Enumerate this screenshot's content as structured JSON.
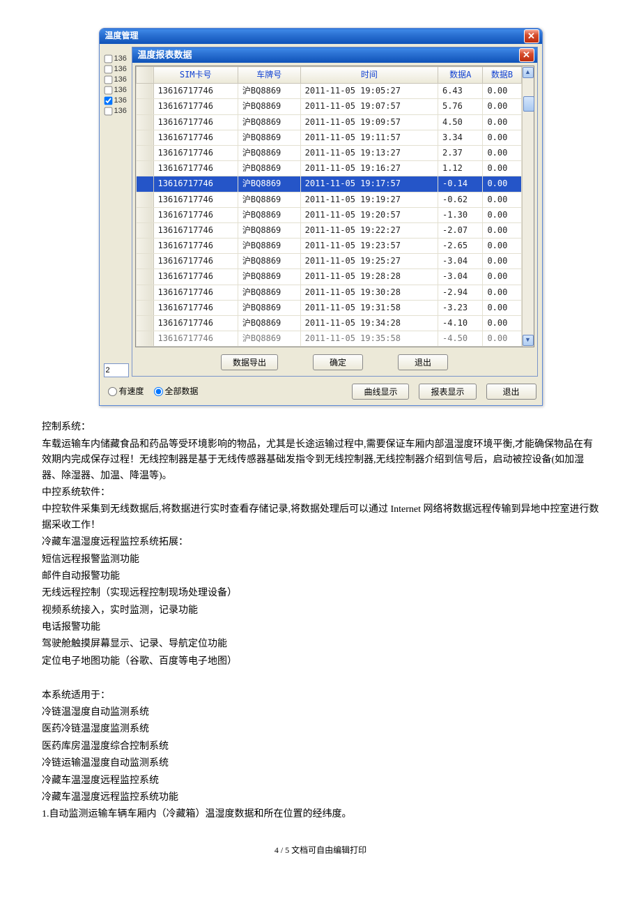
{
  "window": {
    "outer_title": "温度管理",
    "inner_title": "温度报表数据",
    "close_glyph": "✕"
  },
  "left_strip": [
    {
      "checked": false,
      "label": "136"
    },
    {
      "checked": false,
      "label": "136"
    },
    {
      "checked": false,
      "label": "136"
    },
    {
      "checked": false,
      "label": "136"
    },
    {
      "checked": true,
      "label": "136"
    },
    {
      "checked": false,
      "label": "136"
    }
  ],
  "small_input_value": "2",
  "columns": [
    "SIM卡号",
    "车牌号",
    "时间",
    "数据A",
    "数据B"
  ],
  "rows": [
    {
      "sim": "13616717746",
      "plate": "沪BQ8869",
      "time": "2011-11-05 19:05:27",
      "a": "6.43",
      "b": "0.00",
      "sel": false
    },
    {
      "sim": "13616717746",
      "plate": "沪BQ8869",
      "time": "2011-11-05 19:07:57",
      "a": "5.76",
      "b": "0.00",
      "sel": false
    },
    {
      "sim": "13616717746",
      "plate": "沪BQ8869",
      "time": "2011-11-05 19:09:57",
      "a": "4.50",
      "b": "0.00",
      "sel": false
    },
    {
      "sim": "13616717746",
      "plate": "沪BQ8869",
      "time": "2011-11-05 19:11:57",
      "a": "3.34",
      "b": "0.00",
      "sel": false
    },
    {
      "sim": "13616717746",
      "plate": "沪BQ8869",
      "time": "2011-11-05 19:13:27",
      "a": "2.37",
      "b": "0.00",
      "sel": false
    },
    {
      "sim": "13616717746",
      "plate": "沪BQ8869",
      "time": "2011-11-05 19:16:27",
      "a": "1.12",
      "b": "0.00",
      "sel": false
    },
    {
      "sim": "13616717746",
      "plate": "沪BQ8869",
      "time": "2011-11-05 19:17:57",
      "a": "-0.14",
      "b": "0.00",
      "sel": true
    },
    {
      "sim": "13616717746",
      "plate": "沪BQ8869",
      "time": "2011-11-05 19:19:27",
      "a": "-0.62",
      "b": "0.00",
      "sel": false
    },
    {
      "sim": "13616717746",
      "plate": "沪BQ8869",
      "time": "2011-11-05 19:20:57",
      "a": "-1.30",
      "b": "0.00",
      "sel": false
    },
    {
      "sim": "13616717746",
      "plate": "沪BQ8869",
      "time": "2011-11-05 19:22:27",
      "a": "-2.07",
      "b": "0.00",
      "sel": false
    },
    {
      "sim": "13616717746",
      "plate": "沪BQ8869",
      "time": "2011-11-05 19:23:57",
      "a": "-2.65",
      "b": "0.00",
      "sel": false
    },
    {
      "sim": "13616717746",
      "plate": "沪BQ8869",
      "time": "2011-11-05 19:25:27",
      "a": "-3.04",
      "b": "0.00",
      "sel": false
    },
    {
      "sim": "13616717746",
      "plate": "沪BQ8869",
      "time": "2011-11-05 19:28:28",
      "a": "-3.04",
      "b": "0.00",
      "sel": false
    },
    {
      "sim": "13616717746",
      "plate": "沪BQ8869",
      "time": "2011-11-05 19:30:28",
      "a": "-2.94",
      "b": "0.00",
      "sel": false
    },
    {
      "sim": "13616717746",
      "plate": "沪BQ8869",
      "time": "2011-11-05 19:31:58",
      "a": "-3.23",
      "b": "0.00",
      "sel": false
    },
    {
      "sim": "13616717746",
      "plate": "沪BQ8869",
      "time": "2011-11-05 19:34:28",
      "a": "-4.10",
      "b": "0.00",
      "sel": false
    }
  ],
  "cut_row": {
    "sim": "13616717746",
    "plate": "沪BQ8869",
    "time": "2011-11-05 19:35:58",
    "a": "-4.50",
    "b": "0.00"
  },
  "inner_buttons": {
    "export": "数据导出",
    "ok": "确定",
    "exit": "退出"
  },
  "outer_foot": {
    "radio_speed": "有速度",
    "radio_all": "全部数据",
    "btn_curve": "曲线显示",
    "btn_table": "报表显示",
    "btn_exit": "退出"
  },
  "prose": [
    "控制系统：",
    "车载运输车内储藏食品和药品等受环境影响的物品，尤其是长途运输过程中,需要保证车厢内部温湿度环境平衡,才能确保物品在有效期内完成保存过程！无线控制器是基于无线传感器基础发指令到无线控制器,无线控制器介绍到信号后，启动被控设备(如加湿器、除湿器、加温、降温等)。",
    "中控系统软件：",
    "中控软件采集到无线数据后,将数据进行实时查看存储记录,将数据处理后可以通过 Internet 网络将数据远程传输到异地中控室进行数据采收工作！",
    "冷藏车温湿度远程监控系统拓展：",
    "短信远程报警监测功能",
    "邮件自动报警功能",
    "无线远程控制（实现远程控制现场处理设备）",
    "视频系统接入，实时监测，记录功能",
    "电话报警功能",
    "驾驶舱触摸屏幕显示、记录、导航定位功能",
    "定位电子地图功能（谷歌、百度等电子地图）",
    "",
    "本系统适用于：",
    "冷链温湿度自动监测系统",
    "医药冷链温湿度监测系统",
    "医药库房温湿度综合控制系统",
    "冷链运输温湿度自动监测系统",
    "冷藏车温湿度远程监控系统",
    "冷藏车温湿度远程监控系统功能",
    "1.自动监测运输车辆车厢内（冷藏箱）温湿度数据和所在位置的经纬度。"
  ],
  "footer": "4 / 5 文档可自由编辑打印"
}
